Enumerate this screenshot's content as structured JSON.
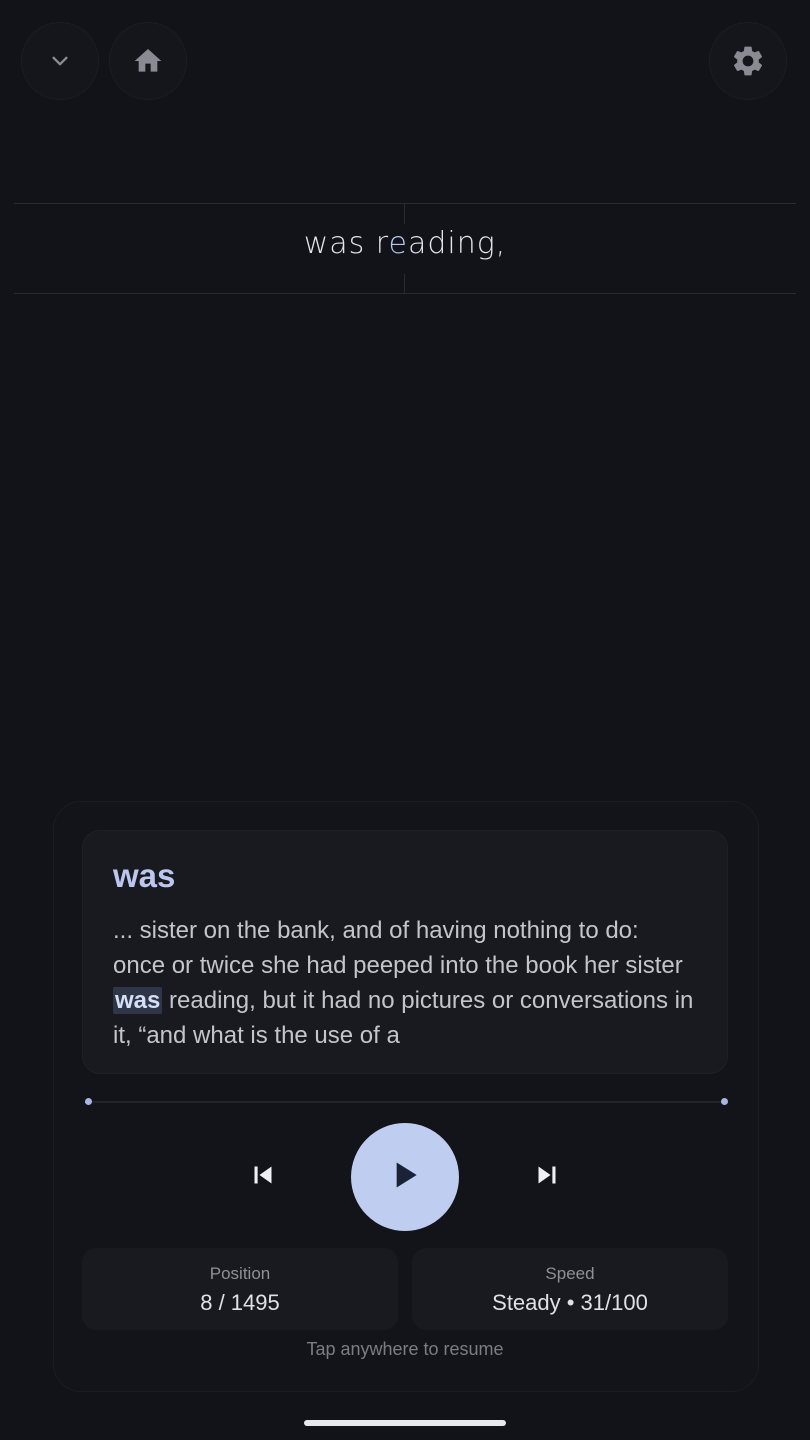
{
  "top_bar": {
    "collapse_icon": "chevron-down-icon",
    "home_icon": "home-icon",
    "settings_icon": "gear-icon"
  },
  "reader": {
    "focus_before": "was r",
    "focus_orp": "e",
    "focus_after": "ading,"
  },
  "context": {
    "word": "was",
    "text_before": "... sister on the bank, and of having nothing to do: once or twice she had peeped into the book her sister ",
    "highlight": "was",
    "text_after": " reading, but it had no pictures or conversations in it, “and what is the use of a"
  },
  "progress": {
    "current": 8,
    "total": 1495
  },
  "controls": {
    "prev_icon": "skip-previous-icon",
    "play_icon": "play-icon",
    "next_icon": "skip-next-icon"
  },
  "stats": {
    "position_label": "Position",
    "position_value": "8 / 1495",
    "speed_label": "Speed",
    "speed_value": "Steady • 31/100"
  },
  "hint": "Tap anywhere to resume",
  "colors": {
    "background": "#121318",
    "accent": "#bfcef0",
    "highlight": "#2f3647"
  }
}
